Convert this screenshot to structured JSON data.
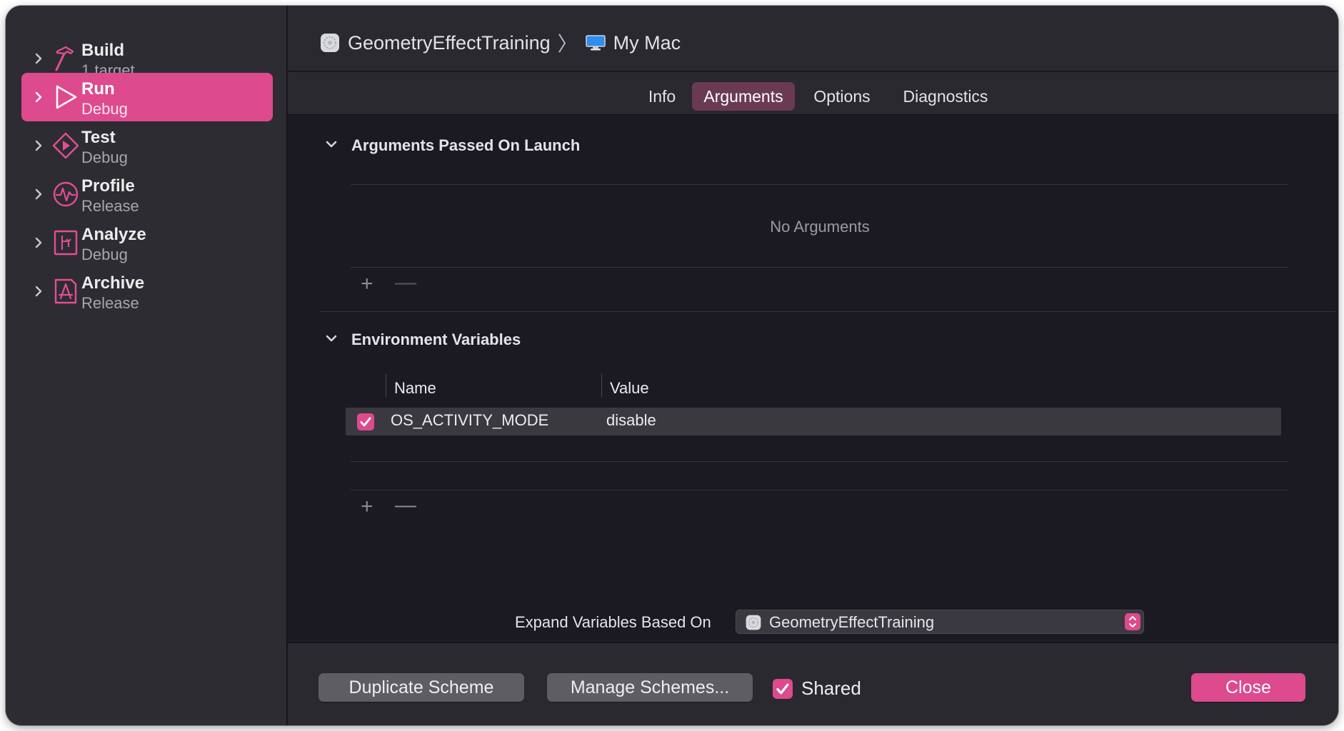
{
  "sidebar": {
    "actions": [
      {
        "name": "Build",
        "sub": "1 target",
        "icon": "hammer-icon"
      },
      {
        "name": "Run",
        "sub": "Debug",
        "icon": "play-icon",
        "selected": true
      },
      {
        "name": "Test",
        "sub": "Debug",
        "icon": "diamond-play-icon"
      },
      {
        "name": "Profile",
        "sub": "Release",
        "icon": "waveform-gauge-icon"
      },
      {
        "name": "Analyze",
        "sub": "Debug",
        "icon": "analyze-icon"
      },
      {
        "name": "Archive",
        "sub": "Release",
        "icon": "archive-icon"
      }
    ]
  },
  "header": {
    "project": "GeometryEffectTraining",
    "separator": "〉",
    "destination": "My Mac"
  },
  "tabs": [
    {
      "label": "Info"
    },
    {
      "label": "Arguments",
      "active": true
    },
    {
      "label": "Options"
    },
    {
      "label": "Diagnostics"
    }
  ],
  "arguments": {
    "title": "Arguments Passed On Launch",
    "empty_text": "No Arguments"
  },
  "environment": {
    "title": "Environment Variables",
    "columns": {
      "name": "Name",
      "value": "Value"
    },
    "rows": [
      {
        "enabled": true,
        "name": "OS_ACTIVITY_MODE",
        "value": "disable"
      }
    ]
  },
  "controls": {
    "add": "+",
    "remove": "—"
  },
  "expand": {
    "label": "Expand Variables Based On",
    "value": "GeometryEffectTraining"
  },
  "footer": {
    "duplicate": "Duplicate Scheme",
    "manage": "Manage Schemes...",
    "shared_label": "Shared",
    "shared_checked": true,
    "close": "Close"
  },
  "colors": {
    "accent": "#dd4a8e",
    "sidebar_bg": "#2d2c33",
    "content_bg": "#1b1a22",
    "tab_active": "#6a3a53"
  }
}
